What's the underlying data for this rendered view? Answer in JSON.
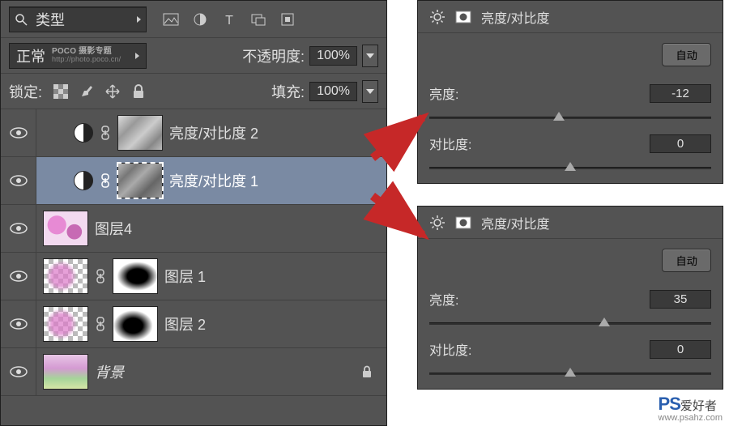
{
  "layers_panel": {
    "type_filter_label": "类型",
    "blend_mode": "正常",
    "watermark": {
      "brand": "POCO 摄影专题",
      "url": "http://photo.poco.cn/"
    },
    "opacity_label": "不透明度:",
    "opacity_value": "100%",
    "lock_label": "锁定:",
    "fill_label": "填充:",
    "fill_value": "100%",
    "layers": [
      {
        "name": "亮度/对比度 2",
        "type": "adjustment",
        "selected": false
      },
      {
        "name": "亮度/对比度 1",
        "type": "adjustment",
        "selected": true
      },
      {
        "name": "图层4",
        "type": "image"
      },
      {
        "name": "图层 1",
        "type": "image_with_mask"
      },
      {
        "name": "图层 2",
        "type": "image_with_mask"
      },
      {
        "name": "背景",
        "type": "background",
        "locked": true
      }
    ]
  },
  "prop1": {
    "title": "亮度/对比度",
    "auto_label": "自动",
    "brightness_label": "亮度:",
    "brightness_value": "-12",
    "contrast_label": "对比度:",
    "contrast_value": "0"
  },
  "prop2": {
    "title": "亮度/对比度",
    "auto_label": "自动",
    "brightness_label": "亮度:",
    "brightness_value": "35",
    "contrast_label": "对比度:",
    "contrast_value": "0"
  },
  "watermark": {
    "logo": "PS",
    "cn": "爱好者",
    "url": "www.psahz.com"
  }
}
